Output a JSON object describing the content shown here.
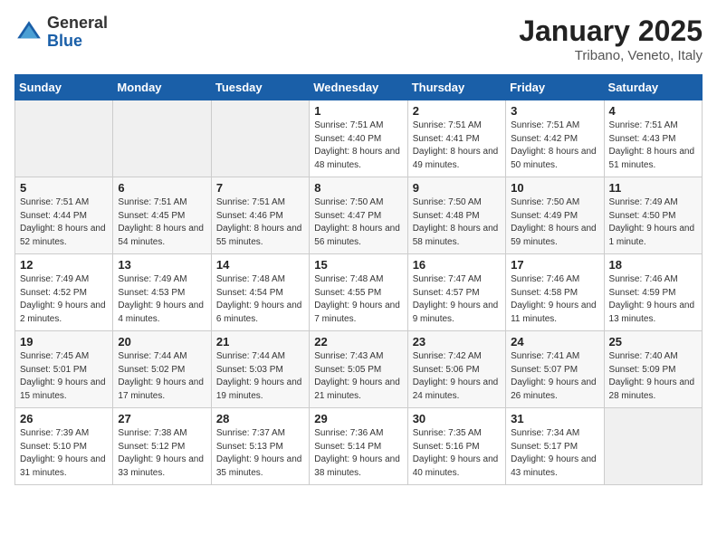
{
  "logo": {
    "general": "General",
    "blue": "Blue"
  },
  "header": {
    "title": "January 2025",
    "subtitle": "Tribano, Veneto, Italy"
  },
  "days_of_week": [
    "Sunday",
    "Monday",
    "Tuesday",
    "Wednesday",
    "Thursday",
    "Friday",
    "Saturday"
  ],
  "weeks": [
    [
      {
        "day": "",
        "sunrise": "",
        "sunset": "",
        "daylight": ""
      },
      {
        "day": "",
        "sunrise": "",
        "sunset": "",
        "daylight": ""
      },
      {
        "day": "",
        "sunrise": "",
        "sunset": "",
        "daylight": ""
      },
      {
        "day": "1",
        "sunrise": "Sunrise: 7:51 AM",
        "sunset": "Sunset: 4:40 PM",
        "daylight": "Daylight: 8 hours and 48 minutes."
      },
      {
        "day": "2",
        "sunrise": "Sunrise: 7:51 AM",
        "sunset": "Sunset: 4:41 PM",
        "daylight": "Daylight: 8 hours and 49 minutes."
      },
      {
        "day": "3",
        "sunrise": "Sunrise: 7:51 AM",
        "sunset": "Sunset: 4:42 PM",
        "daylight": "Daylight: 8 hours and 50 minutes."
      },
      {
        "day": "4",
        "sunrise": "Sunrise: 7:51 AM",
        "sunset": "Sunset: 4:43 PM",
        "daylight": "Daylight: 8 hours and 51 minutes."
      }
    ],
    [
      {
        "day": "5",
        "sunrise": "Sunrise: 7:51 AM",
        "sunset": "Sunset: 4:44 PM",
        "daylight": "Daylight: 8 hours and 52 minutes."
      },
      {
        "day": "6",
        "sunrise": "Sunrise: 7:51 AM",
        "sunset": "Sunset: 4:45 PM",
        "daylight": "Daylight: 8 hours and 54 minutes."
      },
      {
        "day": "7",
        "sunrise": "Sunrise: 7:51 AM",
        "sunset": "Sunset: 4:46 PM",
        "daylight": "Daylight: 8 hours and 55 minutes."
      },
      {
        "day": "8",
        "sunrise": "Sunrise: 7:50 AM",
        "sunset": "Sunset: 4:47 PM",
        "daylight": "Daylight: 8 hours and 56 minutes."
      },
      {
        "day": "9",
        "sunrise": "Sunrise: 7:50 AM",
        "sunset": "Sunset: 4:48 PM",
        "daylight": "Daylight: 8 hours and 58 minutes."
      },
      {
        "day": "10",
        "sunrise": "Sunrise: 7:50 AM",
        "sunset": "Sunset: 4:49 PM",
        "daylight": "Daylight: 8 hours and 59 minutes."
      },
      {
        "day": "11",
        "sunrise": "Sunrise: 7:49 AM",
        "sunset": "Sunset: 4:50 PM",
        "daylight": "Daylight: 9 hours and 1 minute."
      }
    ],
    [
      {
        "day": "12",
        "sunrise": "Sunrise: 7:49 AM",
        "sunset": "Sunset: 4:52 PM",
        "daylight": "Daylight: 9 hours and 2 minutes."
      },
      {
        "day": "13",
        "sunrise": "Sunrise: 7:49 AM",
        "sunset": "Sunset: 4:53 PM",
        "daylight": "Daylight: 9 hours and 4 minutes."
      },
      {
        "day": "14",
        "sunrise": "Sunrise: 7:48 AM",
        "sunset": "Sunset: 4:54 PM",
        "daylight": "Daylight: 9 hours and 6 minutes."
      },
      {
        "day": "15",
        "sunrise": "Sunrise: 7:48 AM",
        "sunset": "Sunset: 4:55 PM",
        "daylight": "Daylight: 9 hours and 7 minutes."
      },
      {
        "day": "16",
        "sunrise": "Sunrise: 7:47 AM",
        "sunset": "Sunset: 4:57 PM",
        "daylight": "Daylight: 9 hours and 9 minutes."
      },
      {
        "day": "17",
        "sunrise": "Sunrise: 7:46 AM",
        "sunset": "Sunset: 4:58 PM",
        "daylight": "Daylight: 9 hours and 11 minutes."
      },
      {
        "day": "18",
        "sunrise": "Sunrise: 7:46 AM",
        "sunset": "Sunset: 4:59 PM",
        "daylight": "Daylight: 9 hours and 13 minutes."
      }
    ],
    [
      {
        "day": "19",
        "sunrise": "Sunrise: 7:45 AM",
        "sunset": "Sunset: 5:01 PM",
        "daylight": "Daylight: 9 hours and 15 minutes."
      },
      {
        "day": "20",
        "sunrise": "Sunrise: 7:44 AM",
        "sunset": "Sunset: 5:02 PM",
        "daylight": "Daylight: 9 hours and 17 minutes."
      },
      {
        "day": "21",
        "sunrise": "Sunrise: 7:44 AM",
        "sunset": "Sunset: 5:03 PM",
        "daylight": "Daylight: 9 hours and 19 minutes."
      },
      {
        "day": "22",
        "sunrise": "Sunrise: 7:43 AM",
        "sunset": "Sunset: 5:05 PM",
        "daylight": "Daylight: 9 hours and 21 minutes."
      },
      {
        "day": "23",
        "sunrise": "Sunrise: 7:42 AM",
        "sunset": "Sunset: 5:06 PM",
        "daylight": "Daylight: 9 hours and 24 minutes."
      },
      {
        "day": "24",
        "sunrise": "Sunrise: 7:41 AM",
        "sunset": "Sunset: 5:07 PM",
        "daylight": "Daylight: 9 hours and 26 minutes."
      },
      {
        "day": "25",
        "sunrise": "Sunrise: 7:40 AM",
        "sunset": "Sunset: 5:09 PM",
        "daylight": "Daylight: 9 hours and 28 minutes."
      }
    ],
    [
      {
        "day": "26",
        "sunrise": "Sunrise: 7:39 AM",
        "sunset": "Sunset: 5:10 PM",
        "daylight": "Daylight: 9 hours and 31 minutes."
      },
      {
        "day": "27",
        "sunrise": "Sunrise: 7:38 AM",
        "sunset": "Sunset: 5:12 PM",
        "daylight": "Daylight: 9 hours and 33 minutes."
      },
      {
        "day": "28",
        "sunrise": "Sunrise: 7:37 AM",
        "sunset": "Sunset: 5:13 PM",
        "daylight": "Daylight: 9 hours and 35 minutes."
      },
      {
        "day": "29",
        "sunrise": "Sunrise: 7:36 AM",
        "sunset": "Sunset: 5:14 PM",
        "daylight": "Daylight: 9 hours and 38 minutes."
      },
      {
        "day": "30",
        "sunrise": "Sunrise: 7:35 AM",
        "sunset": "Sunset: 5:16 PM",
        "daylight": "Daylight: 9 hours and 40 minutes."
      },
      {
        "day": "31",
        "sunrise": "Sunrise: 7:34 AM",
        "sunset": "Sunset: 5:17 PM",
        "daylight": "Daylight: 9 hours and 43 minutes."
      },
      {
        "day": "",
        "sunrise": "",
        "sunset": "",
        "daylight": ""
      }
    ]
  ]
}
